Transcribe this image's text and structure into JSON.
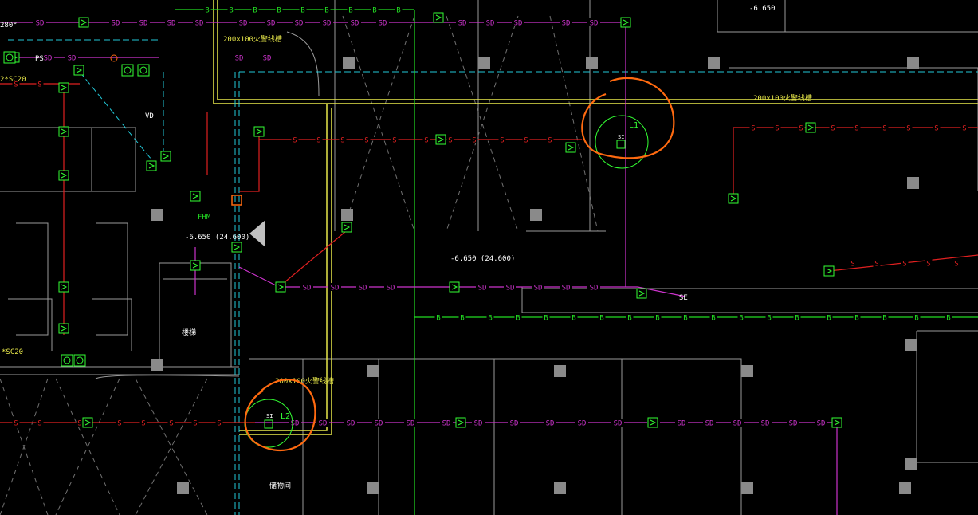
{
  "labels": {
    "duct_top": "200×100火警线槽",
    "duct_right": "200×100火警线槽",
    "duct_bottom": "200×100火警线槽",
    "elev_a": "-6.650 (24.600)",
    "elev_b": "-6.650 (24.600)",
    "elev_top": "-6.650",
    "cable_a": "2*SC20",
    "cable_b": "*SC20",
    "cable_top": "280°",
    "fhm": "FHM",
    "se": "SE",
    "ps": "PS",
    "vd": "VD",
    "l1": "L1",
    "l2": "L2",
    "si": "SI",
    "s": "S",
    "sd": "SD",
    "b": "B",
    "room": "储物间",
    "stair": "楼梯"
  },
  "colors": {
    "background": "#000000",
    "sd_line": "#cc33cc",
    "s_line": "#e02020",
    "b_line": "#22dd22",
    "cyan_line": "#22c8d8",
    "duct": "#e8e84a",
    "wall": "#9a9a9a",
    "marker": "#ff6a10",
    "device": "#33ff33"
  }
}
